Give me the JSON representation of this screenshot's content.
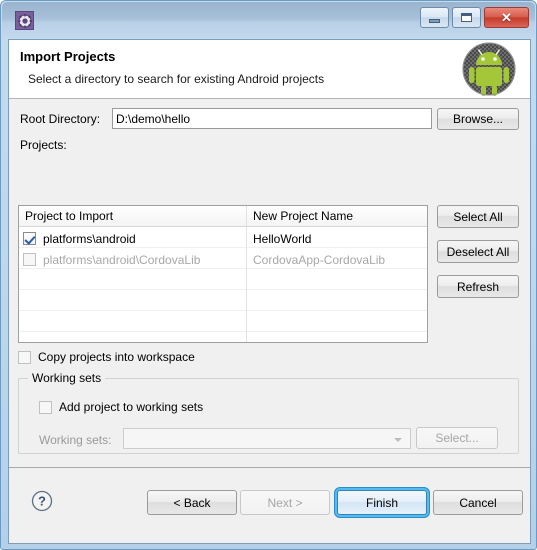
{
  "window": {
    "icon": "gear-icon",
    "controls": {
      "minimize": "minimize-icon",
      "maximize": "maximize-icon",
      "close": "close-icon",
      "close_glyph": "✕"
    }
  },
  "banner": {
    "title": "Import Projects",
    "subtitle": "Select a directory to search for existing Android projects",
    "icon": "android-robot-icon"
  },
  "form": {
    "root_directory_label": "Root Directory:",
    "root_directory_value": "D:\\demo\\hello",
    "root_directory_placeholder": "",
    "browse_label": "Browse...",
    "projects_label": "Projects:"
  },
  "side_buttons": {
    "select_all": "Select All",
    "deselect_all": "Deselect All",
    "refresh": "Refresh"
  },
  "table": {
    "columns": [
      "Project to Import",
      "New Project Name"
    ],
    "rows": [
      {
        "checked": true,
        "enabled": true,
        "project": "platforms\\android",
        "new_name": "HelloWorld"
      },
      {
        "checked": false,
        "enabled": false,
        "project": "platforms\\android\\CordovaLib",
        "new_name": "CordovaApp-CordovaLib"
      }
    ],
    "empty_row_count": 4
  },
  "options": {
    "copy_projects_label": "Copy projects into workspace",
    "copy_projects_checked": false
  },
  "working_sets": {
    "group_title": "Working sets",
    "add_project_label": "Add project to working sets",
    "add_project_checked": false,
    "working_sets_label": "Working sets:",
    "combo_value": "",
    "select_label": "Select...",
    "enabled": false
  },
  "footer": {
    "help": "help-icon",
    "back": "< Back",
    "next": "Next >",
    "finish": "Finish",
    "cancel": "Cancel",
    "next_enabled": false,
    "finish_focused": true
  },
  "colors": {
    "accent": "#4ebef5",
    "titlebar_top": "#9ab4cf",
    "titlebar_bottom": "#c3d9ed",
    "body": "#f0f0f0",
    "android_green": "#a4c639",
    "disabled_text": "#a6a6a6"
  }
}
